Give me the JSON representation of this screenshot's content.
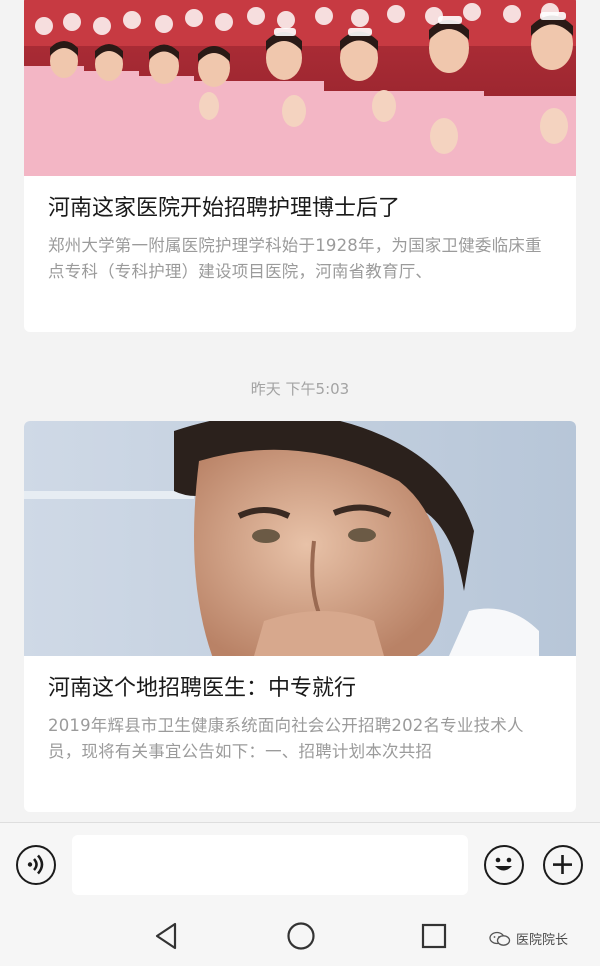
{
  "feed": {
    "articles": [
      {
        "title": "河南这家医院开始招聘护理博士后了",
        "summary": "郑州大学第一附属医院护理学科始于1928年，为国家卫健委临床重点专科（专科护理）建设项目医院，河南省教育厅、",
        "image": "photo of nurses in pink uniforms applauding"
      },
      {
        "title": "河南这个地招聘医生：中专就行",
        "summary": "2019年辉县市卫生健康系统面向社会公开招聘202名专业技术人员，现将有关事宜公告如下：一、招聘计划本次共招",
        "image": "photo of a man with hand at chin"
      }
    ],
    "timestamp": "昨天 下午5:03"
  },
  "input_bar": {
    "voice_icon": "voice-icon",
    "text_value": "",
    "emoji_icon": "emoji-icon",
    "plus_icon": "plus-icon"
  },
  "nav": {
    "back_icon": "back-triangle-icon",
    "home_icon": "home-circle-icon",
    "recent_icon": "recent-square-icon"
  },
  "watermark": {
    "text": "医院院长",
    "icon": "wechat-icon"
  },
  "colors": {
    "background": "#f3f3f3",
    "card": "#ffffff",
    "title": "#1a1a1a",
    "summary": "#9b9b9b",
    "timestamp": "#a3a3a3",
    "icon": "#1b1b1b"
  }
}
